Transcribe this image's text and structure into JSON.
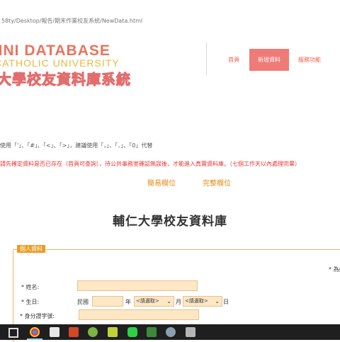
{
  "address_bar": {
    "url": "58ty/Desktop/報告/期末作業校友系統/NewData.html"
  },
  "header": {
    "logo_line1": "MNI DATABASE",
    "logo_line2": "CATHOLIC UNIVERSITY",
    "logo_line3": "大學校友資料庫系統",
    "nav": [
      {
        "label": "首頁",
        "active": false
      },
      {
        "label": "新增資料",
        "active": true
      },
      {
        "label": "服務功能",
        "active": false
      }
    ]
  },
  "notices": {
    "chars_warning": "使用「'」、「#」、「<」、「>」，建議使用「，」、「．」、「0」代替",
    "verify_warning": "請先確定資料是否已存在（首頁可查詢），待公共事務室確認無誤後，才能進入真實資料庫。（七個工作天以內處理完畢）"
  },
  "tabs": {
    "simple": "簡易欄位",
    "full": "完整欄位"
  },
  "page_title": "輔仁大學校友資料庫",
  "form": {
    "legend": "個人資料",
    "required_note": "* 為必",
    "name_label": "* 姓名:",
    "birthday_label": "* 生日:",
    "era_label": "民國",
    "year_label": "年",
    "month_placeholder": "<請選取>",
    "month_label": "月",
    "day_placeholder": "<請選取>",
    "day_label": "日",
    "id_label": "* 身分證字號:"
  },
  "colors": {
    "accent": "#ef7b77",
    "orange": "#ef9a23",
    "input_bg": "#fde7c5"
  }
}
